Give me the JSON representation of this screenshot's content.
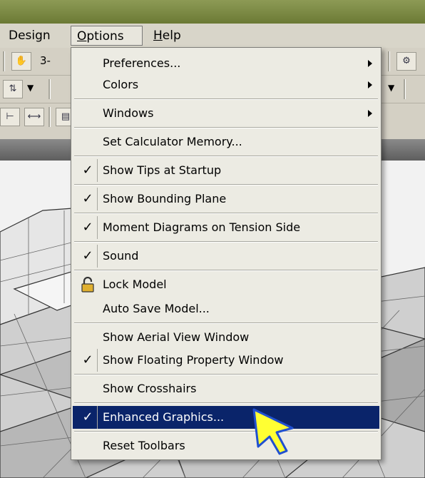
{
  "menubar": {
    "items": [
      {
        "label": "Design"
      },
      {
        "label": "Options",
        "open": true
      },
      {
        "label": "Help"
      }
    ]
  },
  "toolbar": {
    "row1_text": "3-"
  },
  "options_menu": {
    "items": [
      {
        "label": "Preferences...",
        "checked": false,
        "submenu": true
      },
      {
        "label": "Colors",
        "checked": false,
        "submenu": true
      },
      {
        "label": "Windows",
        "checked": false,
        "submenu": true
      },
      {
        "label": "Set Calculator Memory...",
        "checked": false
      },
      {
        "label": "Show Tips at Startup",
        "checked": true
      },
      {
        "label": "Show Bounding Plane",
        "checked": true
      },
      {
        "label": "Moment Diagrams on Tension Side",
        "checked": true
      },
      {
        "label": "Sound",
        "checked": true
      },
      {
        "label": "Lock Model",
        "icon": "lock-icon"
      },
      {
        "label": "Auto Save Model...",
        "checked": false
      },
      {
        "label": "Show Aerial View Window",
        "checked": false
      },
      {
        "label": "Show Floating Property Window",
        "checked": true
      },
      {
        "label": "Show Crosshairs",
        "checked": false
      },
      {
        "label": "Enhanced Graphics...",
        "checked": true,
        "highlighted": true
      },
      {
        "label": "Reset Toolbars",
        "checked": false
      }
    ],
    "check_glyph": "✓"
  },
  "colors": {
    "highlight": "#0a246a",
    "menu_bg": "#ecebe3",
    "cursor_fill": "#ffff33",
    "cursor_outline": "#2050d0"
  }
}
